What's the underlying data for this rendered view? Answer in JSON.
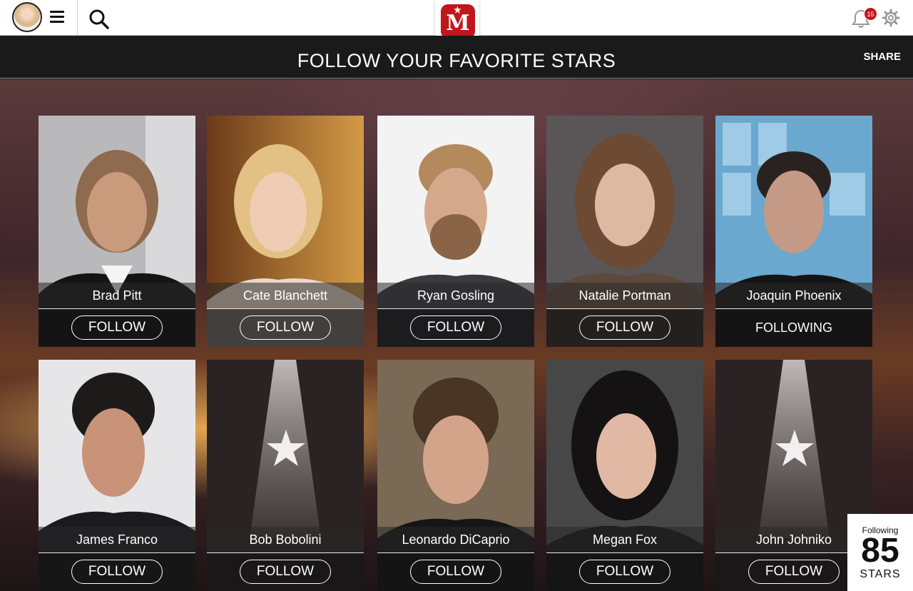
{
  "header": {
    "logo_letter": "M",
    "notifications_count": "15",
    "icons": [
      "avatar",
      "menu-icon",
      "search-icon",
      "bell-icon",
      "gear-icon"
    ],
    "accent_color": "#c0171d"
  },
  "title_bar": {
    "title": "FOLLOW YOUR FAVORITE STARS",
    "share_label": "SHARE"
  },
  "stars": [
    {
      "name": "Brad Pitt",
      "action": "FOLLOW",
      "following": false
    },
    {
      "name": "Cate Blanchett",
      "action": "FOLLOW",
      "following": false
    },
    {
      "name": "Ryan Gosling",
      "action": "FOLLOW",
      "following": false
    },
    {
      "name": "Natalie Portman",
      "action": "FOLLOW",
      "following": false
    },
    {
      "name": "Joaquin Phoenix",
      "action": "FOLLOWING",
      "following": true
    },
    {
      "name": "James Franco",
      "action": "FOLLOW",
      "following": false
    },
    {
      "name": "Bob Bobolini",
      "action": "FOLLOW",
      "following": false
    },
    {
      "name": "Leonardo DiCaprio",
      "action": "FOLLOW",
      "following": false
    },
    {
      "name": "Megan Fox",
      "action": "FOLLOW",
      "following": false
    },
    {
      "name": "John Johniko",
      "action": "FOLLOW",
      "following": false
    }
  ],
  "counter": {
    "label": "Following",
    "number": "85",
    "unit": "STARS"
  }
}
